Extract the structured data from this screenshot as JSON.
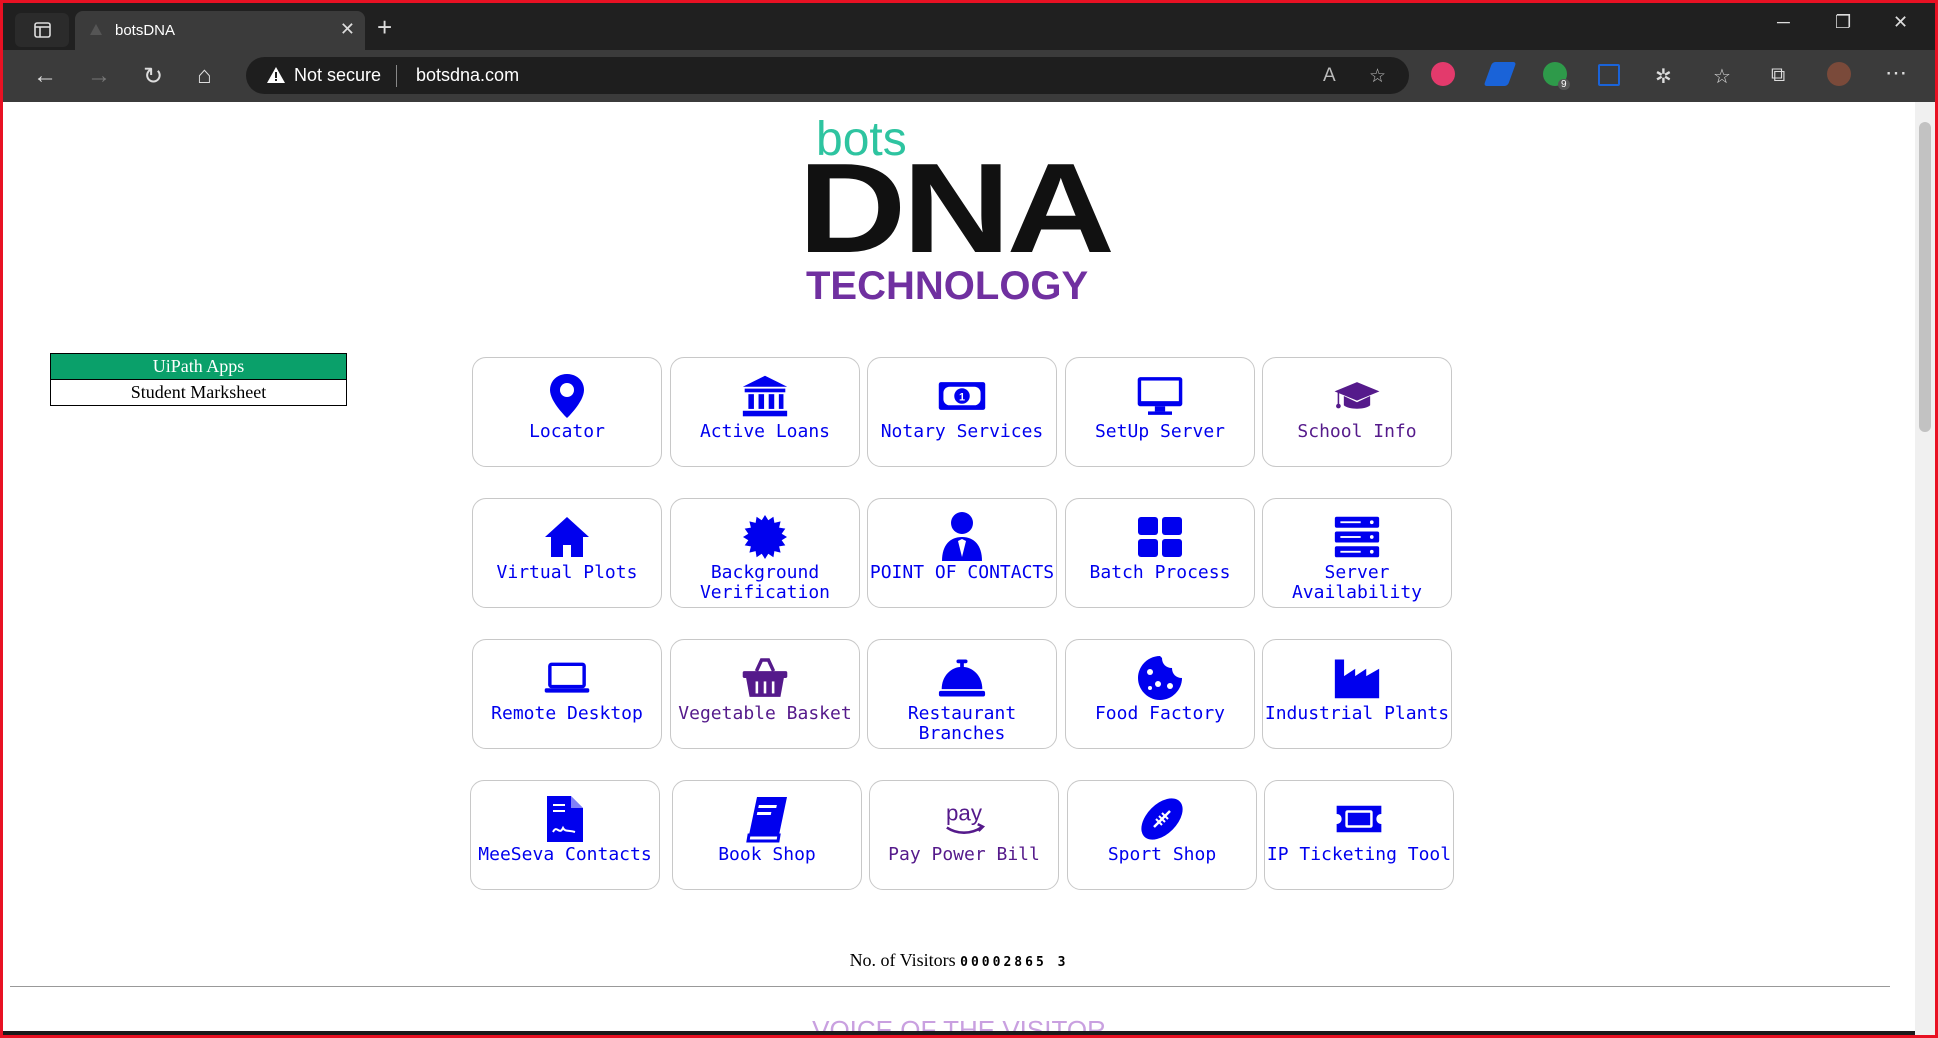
{
  "browser": {
    "tab_title": "botsDNA",
    "security_label": "Not secure",
    "url": "botsdna.com",
    "extension_badge": "9"
  },
  "logo": {
    "bots": "bots",
    "dna": "DNA",
    "technology": "TECHNOLOGY"
  },
  "apps_table": {
    "header": "UiPath Apps",
    "items": [
      "Student Marksheet"
    ]
  },
  "tiles": [
    {
      "label": "Locator",
      "icon": "location-pin-icon",
      "color": "#0000ee"
    },
    {
      "label": "Active Loans",
      "icon": "bank-icon",
      "color": "#0000ee"
    },
    {
      "label": "Notary Services",
      "icon": "money-bill-icon",
      "color": "#0000ee"
    },
    {
      "label": "SetUp Server",
      "icon": "desktop-monitor-icon",
      "color": "#0000ee"
    },
    {
      "label": "School Info",
      "icon": "graduation-cap-icon",
      "color": "#551a8b"
    },
    {
      "label": "Virtual Plots",
      "icon": "house-icon",
      "color": "#0000ee"
    },
    {
      "label": "Background Verification",
      "icon": "certificate-icon",
      "color": "#0000ee"
    },
    {
      "label": "POINT OF CONTACTS",
      "icon": "user-tie-icon",
      "color": "#0000ee"
    },
    {
      "label": "Batch Process",
      "icon": "grid-icon",
      "color": "#0000ee"
    },
    {
      "label": "Server Availability",
      "icon": "server-icon",
      "color": "#0000ee"
    },
    {
      "label": "Remote Desktop",
      "icon": "laptop-icon",
      "color": "#0000ee"
    },
    {
      "label": "Vegetable Basket",
      "icon": "basket-icon",
      "color": "#551a8b"
    },
    {
      "label": "Restaurant Branches",
      "icon": "concierge-bell-icon",
      "color": "#0000ee"
    },
    {
      "label": "Food Factory",
      "icon": "cookie-icon",
      "color": "#0000ee"
    },
    {
      "label": "Industrial Plants",
      "icon": "industry-icon",
      "color": "#0000ee"
    },
    {
      "label": "MeeSeva Contacts",
      "icon": "contract-file-icon",
      "color": "#0000ee"
    },
    {
      "label": "Book Shop",
      "icon": "book-icon",
      "color": "#0000ee"
    },
    {
      "label": "Pay Power Bill",
      "icon": "amazon-pay-icon",
      "color": "#551a8b"
    },
    {
      "label": "Sport Shop",
      "icon": "football-icon",
      "color": "#0000ee"
    },
    {
      "label": "IP Ticketing Tool",
      "icon": "ticket-icon",
      "color": "#0000ee"
    }
  ],
  "visitors": {
    "label": "No. of Visitors",
    "count": "00002865 3"
  },
  "footer_heading": "VOICE OF THE VISITOR"
}
